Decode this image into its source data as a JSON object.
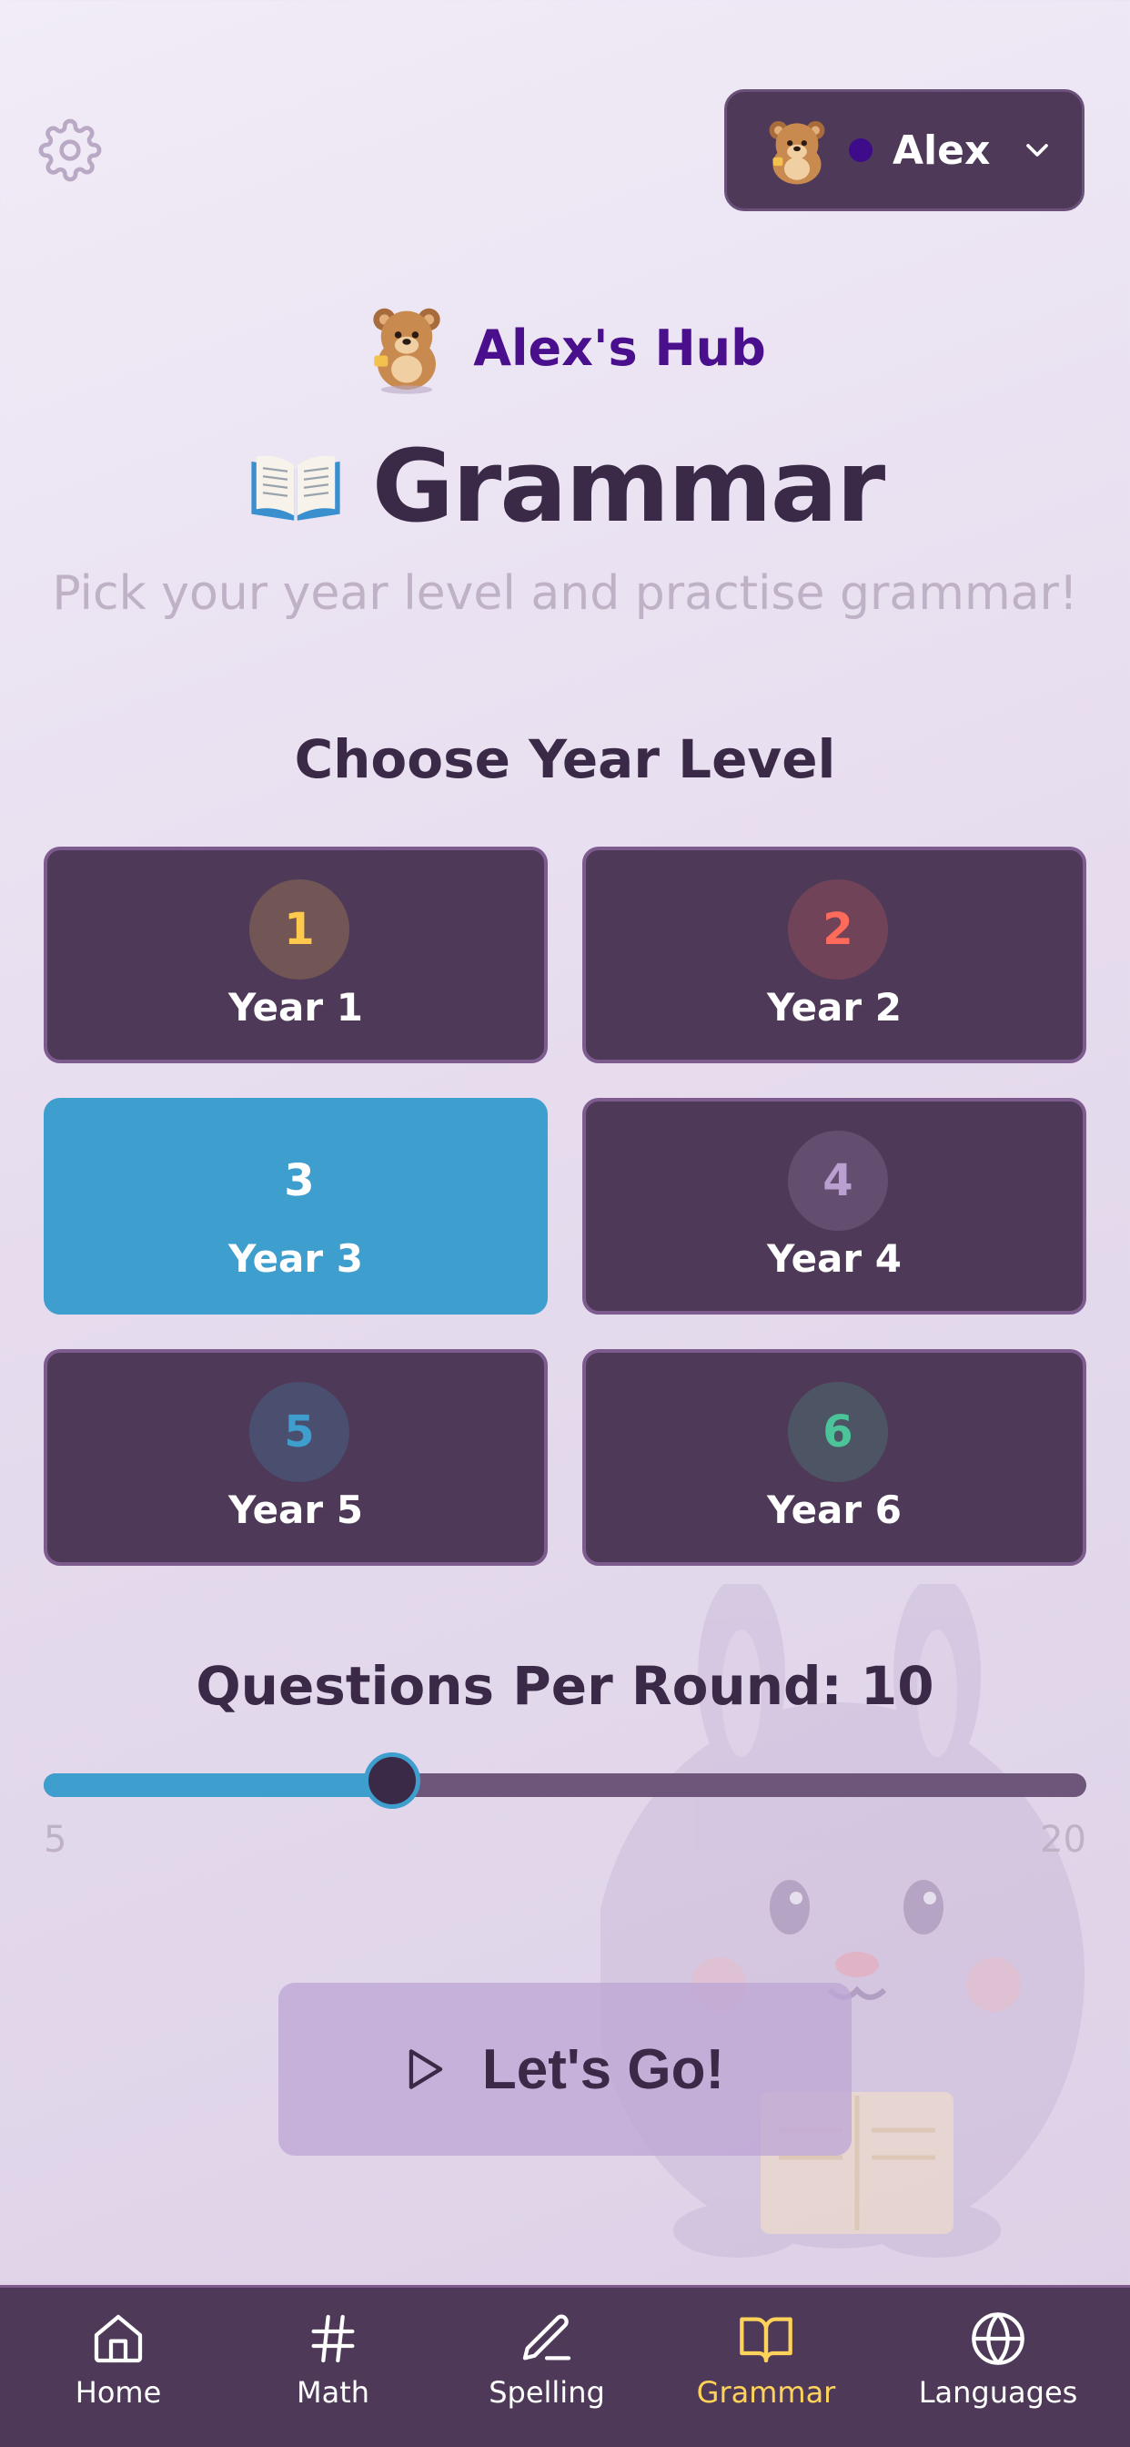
{
  "header": {
    "settings_icon": "gear-icon",
    "user": {
      "name": "Alex",
      "avatar": "bear-avatar",
      "status_color": "#3e0c8a"
    }
  },
  "hub": {
    "title": "Alex's Hub",
    "icon": "bear-icon"
  },
  "page": {
    "icon": "open-book-emoji",
    "title": "Grammar",
    "subtitle": "Pick your year level and practise grammar!"
  },
  "year_section": {
    "title": "Choose Year Level",
    "selected": 3,
    "years": [
      {
        "number": "1",
        "label": "Year 1",
        "color": "#ffc94d"
      },
      {
        "number": "2",
        "label": "Year 2",
        "color": "#ff6b5a"
      },
      {
        "number": "3",
        "label": "Year 3",
        "color": "#ffffff"
      },
      {
        "number": "4",
        "label": "Year 4",
        "color": "#b9a0d0"
      },
      {
        "number": "5",
        "label": "Year 5",
        "color": "#3e9ecd"
      },
      {
        "number": "6",
        "label": "Year 6",
        "color": "#4cc49a"
      }
    ]
  },
  "questions": {
    "title": "Questions Per Round: 10",
    "value": 10,
    "min": 5,
    "max": 20,
    "min_label": "5",
    "max_label": "20"
  },
  "start_button": {
    "label": "Let's Go!",
    "icon": "play-icon"
  },
  "nav": {
    "active": "grammar",
    "items": [
      {
        "id": "home",
        "label": "Home",
        "icon": "home-icon"
      },
      {
        "id": "math",
        "label": "Math",
        "icon": "hash-icon"
      },
      {
        "id": "spelling",
        "label": "Spelling",
        "icon": "pencil-icon"
      },
      {
        "id": "grammar",
        "label": "Grammar",
        "icon": "book-icon"
      },
      {
        "id": "languages",
        "label": "Languages",
        "icon": "globe-icon"
      }
    ]
  },
  "colors": {
    "accent": "#3e9ecd",
    "card": "#4e3a58",
    "active_nav": "#ffd35a",
    "hub_title": "#4a0f8c"
  }
}
